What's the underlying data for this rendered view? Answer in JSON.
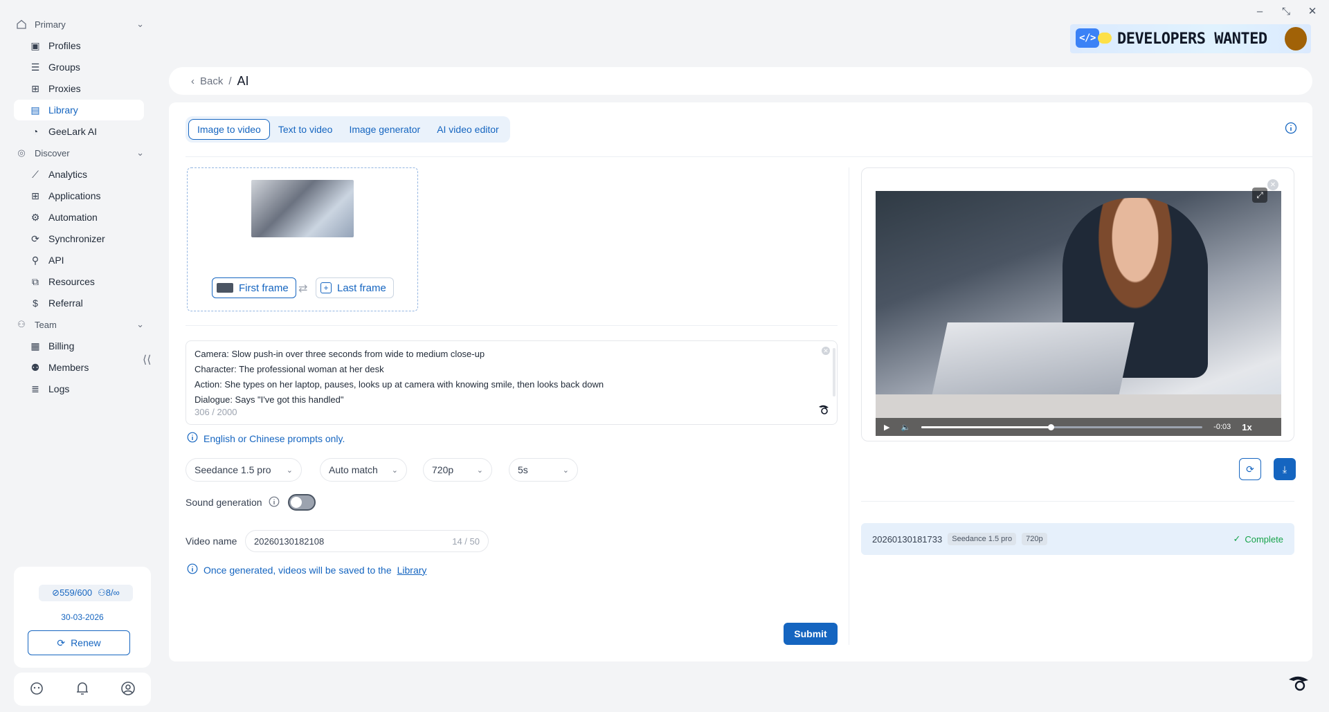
{
  "window": {
    "minimize": "–",
    "restore": "⤡",
    "close": "✕"
  },
  "sidebar": {
    "sections": [
      {
        "label": "Primary",
        "items": [
          {
            "label": "Profiles",
            "icon": "profiles-icon"
          },
          {
            "label": "Groups",
            "icon": "list-icon"
          },
          {
            "label": "Proxies",
            "icon": "proxies-icon"
          },
          {
            "label": "Library",
            "icon": "library-icon",
            "active": true
          },
          {
            "label": "GeeLark AI",
            "icon": "geelark-logo-icon"
          }
        ]
      },
      {
        "label": "Discover",
        "items": [
          {
            "label": "Analytics",
            "icon": "analytics-icon"
          },
          {
            "label": "Applications",
            "icon": "grid-icon"
          },
          {
            "label": "Automation",
            "icon": "robot-icon"
          },
          {
            "label": "Synchronizer",
            "icon": "sync-icon"
          },
          {
            "label": "API",
            "icon": "api-icon"
          },
          {
            "label": "Resources",
            "icon": "resources-icon"
          },
          {
            "label": "Referral",
            "icon": "dollar-icon"
          }
        ]
      },
      {
        "label": "Team",
        "items": [
          {
            "label": "Billing",
            "icon": "billing-icon"
          },
          {
            "label": "Members",
            "icon": "person-icon"
          },
          {
            "label": "Logs",
            "icon": "logs-icon"
          }
        ]
      }
    ],
    "plan": {
      "profiles": "559/600",
      "members": "8/∞",
      "date": "30-03-2026",
      "renew_label": "Renew"
    }
  },
  "banner": {
    "text": "DEVELOPERS WANTED",
    "code": "</>"
  },
  "breadcrumb": {
    "back": "Back",
    "separator": "/",
    "current": "AI"
  },
  "tabs": [
    "Image to video",
    "Text to video",
    "Image generator",
    "AI video editor"
  ],
  "upload": {
    "first_frame": "First frame",
    "last_frame": "Last frame"
  },
  "prompt": {
    "lines": [
      "Camera: Slow push-in over three seconds from wide to medium close-up",
      "Character: The professional woman at her desk",
      "Action: She types on her laptop, pauses, looks up at camera with knowing smile, then looks back down",
      "Dialogue: Says \"I've got this handled\""
    ],
    "count": "306 / 2000"
  },
  "hints": {
    "language": "English or Chinese prompts only.",
    "library_prefix": "Once generated, videos will be saved to the",
    "library_link": "Library"
  },
  "settings": {
    "model": "Seedance 1.5 pro",
    "ratio": "Auto match",
    "resolution": "720p",
    "duration": "5s",
    "sound_label": "Sound generation",
    "sound_on": false,
    "video_name_label": "Video name",
    "video_name": "20260130182108",
    "video_name_count": "14 / 50"
  },
  "submit_label": "Submit",
  "player": {
    "time": "-0:03",
    "speed": "1x",
    "progress": 0.46
  },
  "history": [
    {
      "name": "20260130181733",
      "model": "Seedance 1.5 pro",
      "resolution": "720p",
      "status": "Complete"
    }
  ],
  "colors": {
    "accent": "#1565c0",
    "success": "#16a34a"
  }
}
